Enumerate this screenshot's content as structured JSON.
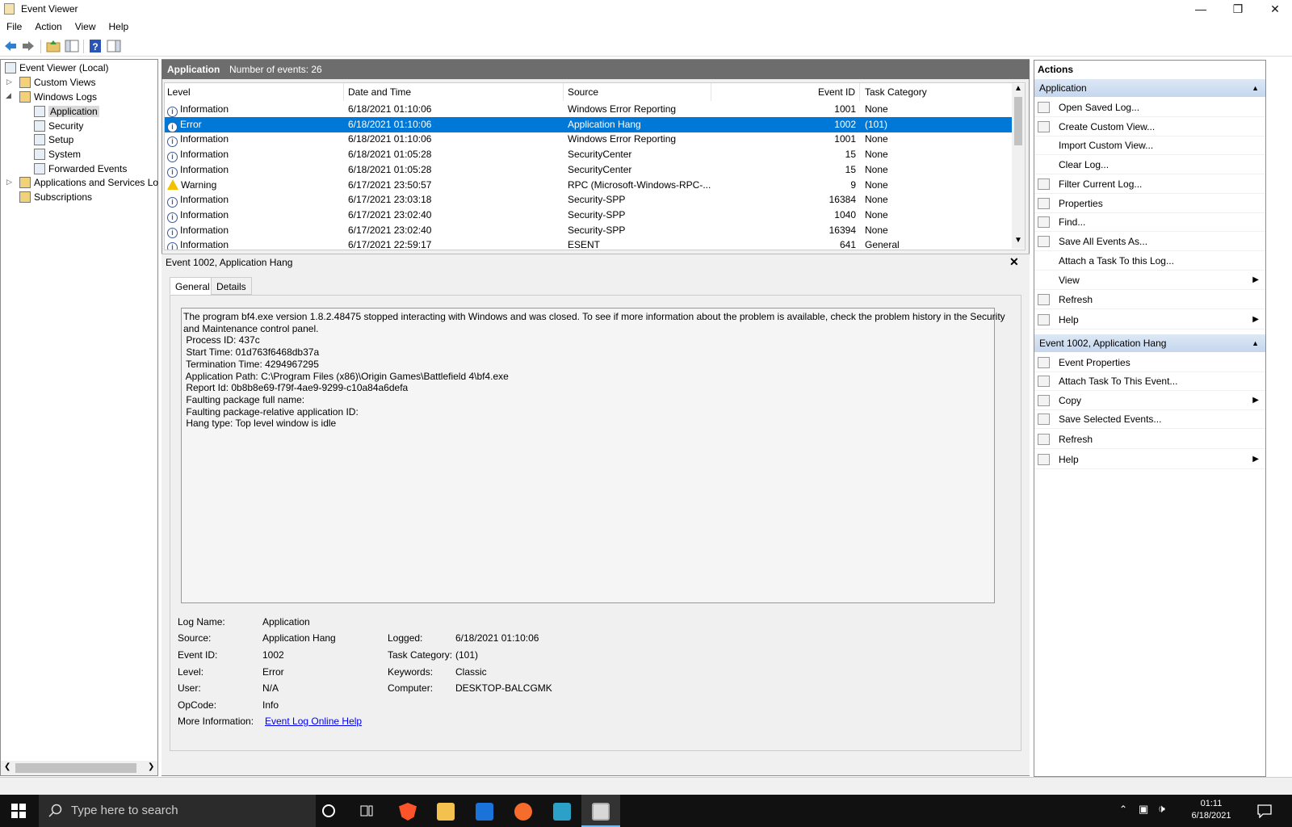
{
  "window": {
    "title": "Event Viewer"
  },
  "menu": [
    "File",
    "Action",
    "View",
    "Help"
  ],
  "tree": {
    "root": "Event Viewer (Local)",
    "custom_views": "Custom Views",
    "windows_logs": "Windows Logs",
    "application": "Application",
    "security": "Security",
    "setup": "Setup",
    "system": "System",
    "forwarded": "Forwarded Events",
    "apps_services": "Applications and Services Lo",
    "subscriptions": "Subscriptions"
  },
  "list_header": {
    "name": "Application",
    "count": "Number of events: 26"
  },
  "columns": {
    "level": "Level",
    "date": "Date and Time",
    "source": "Source",
    "event_id": "Event ID",
    "task": "Task Category"
  },
  "events": [
    {
      "level": "Information",
      "date": "6/18/2021 01:10:06",
      "source": "Windows Error Reporting",
      "id": "1001",
      "task": "None"
    },
    {
      "level": "Error",
      "date": "6/18/2021 01:10:06",
      "source": "Application Hang",
      "id": "1002",
      "task": "(101)"
    },
    {
      "level": "Information",
      "date": "6/18/2021 01:10:06",
      "source": "Windows Error Reporting",
      "id": "1001",
      "task": "None"
    },
    {
      "level": "Information",
      "date": "6/18/2021 01:05:28",
      "source": "SecurityCenter",
      "id": "15",
      "task": "None"
    },
    {
      "level": "Information",
      "date": "6/18/2021 01:05:28",
      "source": "SecurityCenter",
      "id": "15",
      "task": "None"
    },
    {
      "level": "Warning",
      "date": "6/17/2021 23:50:57",
      "source": "RPC (Microsoft-Windows-RPC-...",
      "id": "9",
      "task": "None"
    },
    {
      "level": "Information",
      "date": "6/17/2021 23:03:18",
      "source": "Security-SPP",
      "id": "16384",
      "task": "None"
    },
    {
      "level": "Information",
      "date": "6/17/2021 23:02:40",
      "source": "Security-SPP",
      "id": "1040",
      "task": "None"
    },
    {
      "level": "Information",
      "date": "6/17/2021 23:02:40",
      "source": "Security-SPP",
      "id": "16394",
      "task": "None"
    },
    {
      "level": "Information",
      "date": "6/17/2021 22:59:17",
      "source": "ESENT",
      "id": "641",
      "task": "General"
    }
  ],
  "detail": {
    "title": "Event 1002, Application Hang",
    "tab_general": "General",
    "tab_details": "Details",
    "description": [
      "The program bf4.exe version 1.8.2.48475 stopped interacting with Windows and was closed. To see if more information about the problem is available, check the problem history in the Security",
      "and Maintenance control panel.",
      " Process ID: 437c",
      " Start Time: 01d763f6468db37a",
      " Termination Time: 4294967295",
      " Application Path: C:\\Program Files (x86)\\Origin Games\\Battlefield 4\\bf4.exe",
      " Report Id: 0b8b8e69-f79f-4ae9-9299-c10a84a6defa",
      " Faulting package full name: ",
      " Faulting package-relative application ID: ",
      " Hang type: Top level window is idle"
    ],
    "log_name_label": "Log Name:",
    "log_name": "Application",
    "source_label": "Source:",
    "source": "Application Hang",
    "event_id_label": "Event ID:",
    "event_id": "1002",
    "level_label": "Level:",
    "level": "Error",
    "user_label": "User:",
    "user": "N/A",
    "opcode_label": "OpCode:",
    "opcode": "Info",
    "more_info_label": "More Information:",
    "more_info_link": "Event Log Online Help",
    "logged_label": "Logged:",
    "logged": "6/18/2021 01:10:06",
    "task_label": "Task Category:",
    "task": "(101)",
    "keywords_label": "Keywords:",
    "keywords": "Classic",
    "computer_label": "Computer:",
    "computer": "DESKTOP-BALCGMK"
  },
  "actions": {
    "title": "Actions",
    "section1": "Application",
    "items1": [
      "Open Saved Log...",
      "Create Custom View...",
      "Import Custom View...",
      "Clear Log...",
      "Filter Current Log...",
      "Properties",
      "Find...",
      "Save All Events As...",
      "Attach a Task To this Log...",
      "View",
      "Refresh",
      "Help"
    ],
    "section2": "Event 1002, Application Hang",
    "items2": [
      "Event Properties",
      "Attach Task To This Event...",
      "Copy",
      "Save Selected Events...",
      "Refresh",
      "Help"
    ]
  },
  "taskbar": {
    "search_placeholder": "Type here to search",
    "time": "01:11",
    "date": "6/18/2021"
  },
  "colors": {
    "selection": "#0078d7",
    "header_bar": "#6d6d6d",
    "section": "#c4d6ee"
  }
}
